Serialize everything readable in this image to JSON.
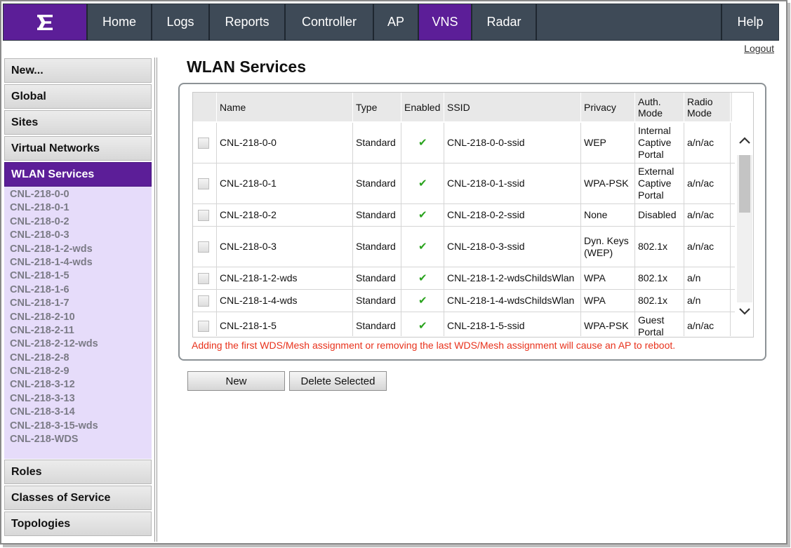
{
  "nav": {
    "items": [
      {
        "label": "Home",
        "width": 92
      },
      {
        "label": "Logs",
        "width": 82
      },
      {
        "label": "Reports",
        "width": 108
      },
      {
        "label": "Controller",
        "width": 126
      },
      {
        "label": "AP",
        "width": 64
      },
      {
        "label": "VNS",
        "width": 76,
        "active": true
      },
      {
        "label": "Radar",
        "width": 92
      }
    ],
    "help_label": "Help",
    "logout_label": "Logout"
  },
  "sidebar": {
    "top_items": [
      "New...",
      "Global",
      "Sites",
      "Virtual Networks",
      "WLAN Services"
    ],
    "active_item": "WLAN Services",
    "services": [
      "CNL-218-0-0",
      "CNL-218-0-1",
      "CNL-218-0-2",
      "CNL-218-0-3",
      "CNL-218-1-2-wds",
      "CNL-218-1-4-wds",
      "CNL-218-1-5",
      "CNL-218-1-6",
      "CNL-218-1-7",
      "CNL-218-2-10",
      "CNL-218-2-11",
      "CNL-218-2-12-wds",
      "CNL-218-2-8",
      "CNL-218-2-9",
      "CNL-218-3-12",
      "CNL-218-3-13",
      "CNL-218-3-14",
      "CNL-218-3-15-wds",
      "CNL-218-WDS"
    ],
    "bottom_items": [
      "Roles",
      "Classes of Service",
      "Topologies"
    ]
  },
  "page": {
    "title": "WLAN Services",
    "warning": "Adding the first WDS/Mesh assignment or removing the last WDS/Mesh assignment will cause an AP to reboot."
  },
  "table": {
    "columns": [
      "Name",
      "Type",
      "Enabled",
      "SSID",
      "Privacy",
      "Auth. Mode",
      "Radio Mode"
    ],
    "rows": [
      {
        "name": "CNL-218-0-0",
        "type": "Standard",
        "enabled": true,
        "ssid": "CNL-218-0-0-ssid",
        "privacy": "WEP",
        "auth": "Internal Captive Portal",
        "radio": "a/n/ac"
      },
      {
        "name": "CNL-218-0-1",
        "type": "Standard",
        "enabled": true,
        "ssid": "CNL-218-0-1-ssid",
        "privacy": "WPA-PSK",
        "auth": "External Captive Portal",
        "radio": "a/n/ac"
      },
      {
        "name": "CNL-218-0-2",
        "type": "Standard",
        "enabled": true,
        "ssid": "CNL-218-0-2-ssid",
        "privacy": "None",
        "auth": "Disabled",
        "radio": "a/n/ac"
      },
      {
        "name": "CNL-218-0-3",
        "type": "Standard",
        "enabled": true,
        "ssid": "CNL-218-0-3-ssid",
        "privacy": "Dyn. Keys (WEP)",
        "auth": "802.1x",
        "radio": "a/n/ac"
      },
      {
        "name": "CNL-218-1-2-wds",
        "type": "Standard",
        "enabled": true,
        "ssid": "CNL-218-1-2-wdsChildsWlan",
        "privacy": "WPA",
        "auth": "802.1x",
        "radio": "a/n"
      },
      {
        "name": "CNL-218-1-4-wds",
        "type": "Standard",
        "enabled": true,
        "ssid": "CNL-218-1-4-wdsChildsWlan",
        "privacy": "WPA",
        "auth": "802.1x",
        "radio": "a/n"
      },
      {
        "name": "CNL-218-1-5",
        "type": "Standard",
        "enabled": true,
        "ssid": "CNL-218-1-5-ssid",
        "privacy": "WPA-PSK",
        "auth": "Guest Portal",
        "radio": "a/n/ac"
      }
    ]
  },
  "buttons": {
    "new_label": "New",
    "delete_label": "Delete Selected"
  },
  "colors": {
    "brand_purple": "#5c1e98",
    "nav_bg": "#3e4a57",
    "warning_red": "#e8321c",
    "check_green": "#2aa31e"
  }
}
